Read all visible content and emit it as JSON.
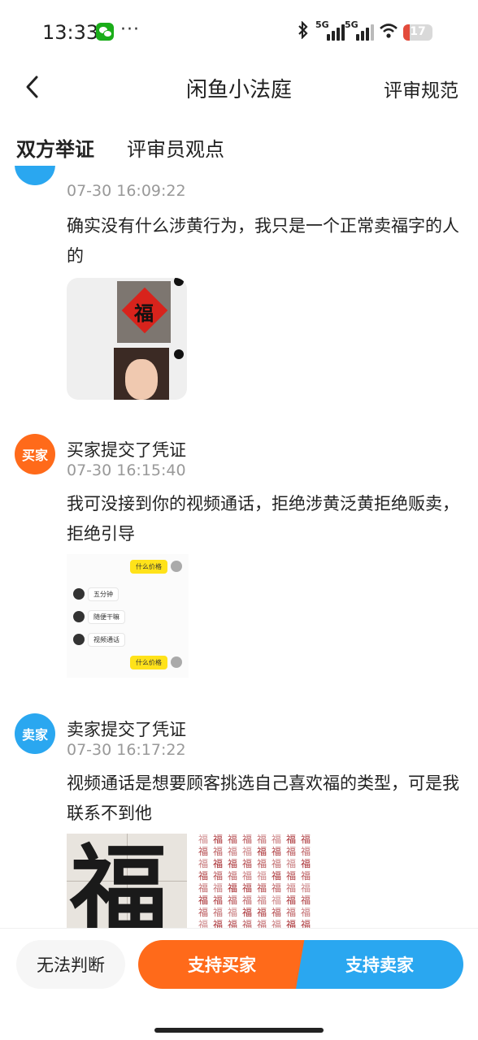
{
  "status_bar": {
    "time": "13:33",
    "more": "···",
    "signal_1_label": "5G",
    "signal_2_label": "5G",
    "battery": "17",
    "icons": [
      "wechat-icon",
      "bluetooth-icon",
      "signal-icon",
      "wifi-icon",
      "battery-icon"
    ],
    "battery_color": "#e34b3b"
  },
  "nav": {
    "title": "闲鱼小法庭",
    "rules_link": "评审规范",
    "back_icon": "chevron-left-icon"
  },
  "tabs": [
    {
      "label": "双方举证",
      "active": true
    },
    {
      "label": "评审员观点",
      "active": false
    }
  ],
  "evidence": [
    {
      "title": "",
      "time": "07-30 16:09:22",
      "text": "确实没有什么涉黄行为，我只是一个正常卖福字的人的",
      "images": [
        "fu-square-photo",
        "girl-selfie-photo"
      ]
    },
    {
      "avatar_label": "买家",
      "title": "买家提交了凭证",
      "time": "07-30 16:15:40",
      "text": "我可没接到你的视频通话，拒绝涉黄泛黄拒绝贩卖，拒绝引导",
      "chat_screenshot": {
        "messages": [
          {
            "side": "right",
            "text": "什么价格"
          },
          {
            "side": "left",
            "text": "五分钟"
          },
          {
            "side": "left",
            "text": "随便干嘛"
          },
          {
            "side": "left",
            "text": "视频通话"
          },
          {
            "side": "right",
            "text": "什么价格"
          }
        ]
      }
    },
    {
      "avatar_label": "卖家",
      "title": "卖家提交了凭证",
      "time": "07-30 16:17:22",
      "text": "视频通话是想要顾客挑选自己喜欢福的类型，可是我联系不到他",
      "calligraphy_char": "福"
    }
  ],
  "actions": {
    "cant_judge": "无法判断",
    "support_buyer": "支持买家",
    "support_seller": "支持卖家"
  },
  "colors": {
    "buyer": "#ff6a1a",
    "seller": "#2aa7f0",
    "tab_highlight": "#ffe21a"
  }
}
